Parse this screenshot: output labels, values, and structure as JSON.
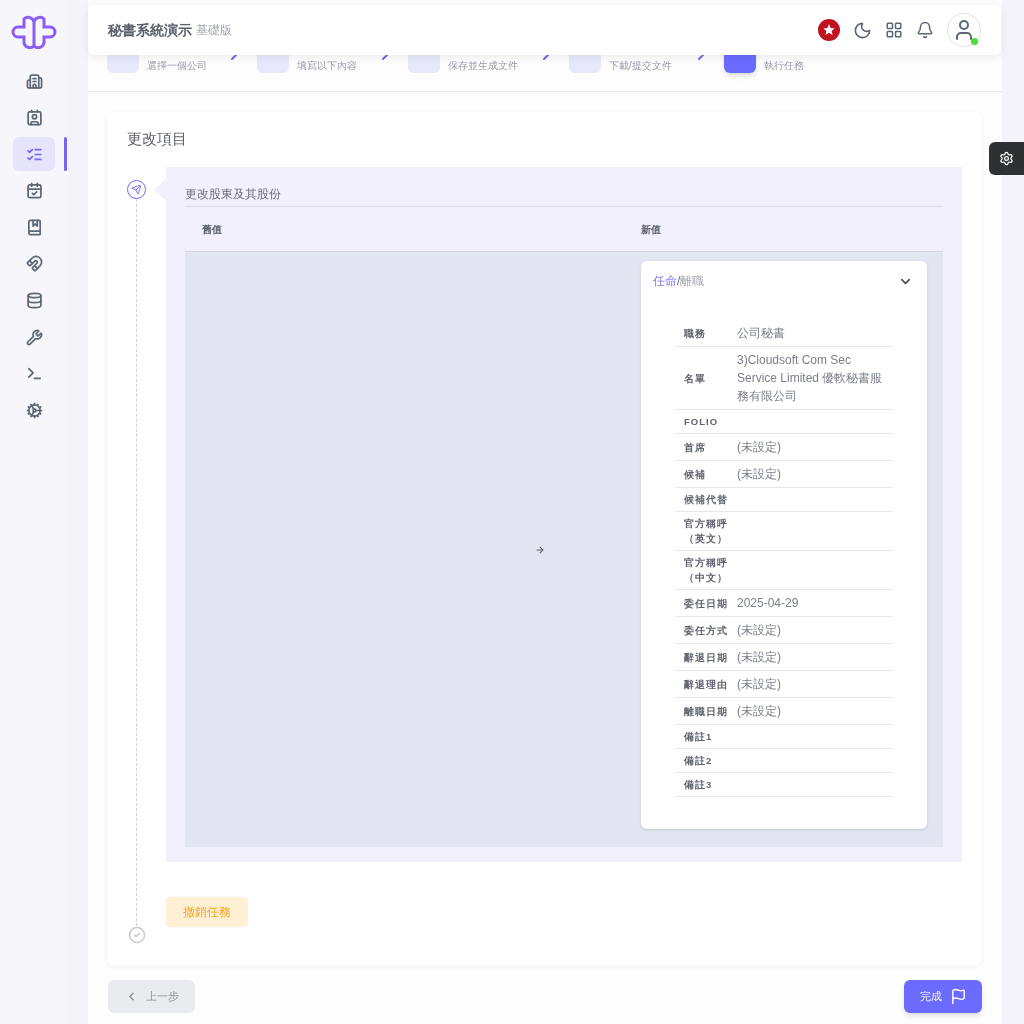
{
  "app": {
    "title": "秘書系統演示",
    "edition": "基礎版"
  },
  "header": {
    "user_online": true
  },
  "sidebar": {
    "items": [
      {
        "selected": false
      },
      {
        "selected": false
      },
      {
        "selected": true
      },
      {
        "selected": false
      },
      {
        "selected": false
      },
      {
        "selected": false
      },
      {
        "selected": false
      },
      {
        "selected": false
      },
      {
        "selected": false
      },
      {
        "selected": false
      }
    ]
  },
  "steps": [
    {
      "subtitle": "選擇一個公司",
      "selected": false
    },
    {
      "subtitle": "填寫以下內容",
      "selected": false
    },
    {
      "subtitle": "保存並生成文件",
      "selected": false
    },
    {
      "subtitle": "下載/提交文件",
      "selected": false
    },
    {
      "subtitle": "執行任務",
      "selected": true
    }
  ],
  "section": {
    "title": "更改項目"
  },
  "change": {
    "title": "更改股東及其股份",
    "columns": [
      "舊值",
      "新值"
    ],
    "record": {
      "options": [
        {
          "label": "任命",
          "selected": true
        },
        {
          "label": "離職",
          "selected": false
        }
      ],
      "separator": "/",
      "expanded": true,
      "fields": [
        {
          "label": "職務",
          "value": "公司秘書"
        },
        {
          "label": "名單",
          "value": "3)Cloudsoft Com Sec Service Limited 優軟秘書服務有限公司"
        },
        {
          "label": "FOLIO"
        },
        {
          "label": "首席",
          "value": "(未設定)"
        },
        {
          "label": "候補",
          "value": "(未設定)"
        },
        {
          "label": "候補代替"
        },
        {
          "label": "官方稱呼（英文）"
        },
        {
          "label": "官方稱呼（中文）"
        },
        {
          "label": "委任日期",
          "value": "2025-04-29"
        },
        {
          "label": "委任方式",
          "value": "(未設定)"
        },
        {
          "label": "辭退日期",
          "value": "(未設定)"
        },
        {
          "label": "辭退理由",
          "value": "(未設定)"
        },
        {
          "label": "離職日期",
          "value": "(未設定)"
        },
        {
          "label": "備註1"
        },
        {
          "label": "備註2"
        },
        {
          "label": "備註3"
        }
      ]
    }
  },
  "cancel_button": "撤銷任務",
  "prev_button": "上一步",
  "done_button": "完成"
}
